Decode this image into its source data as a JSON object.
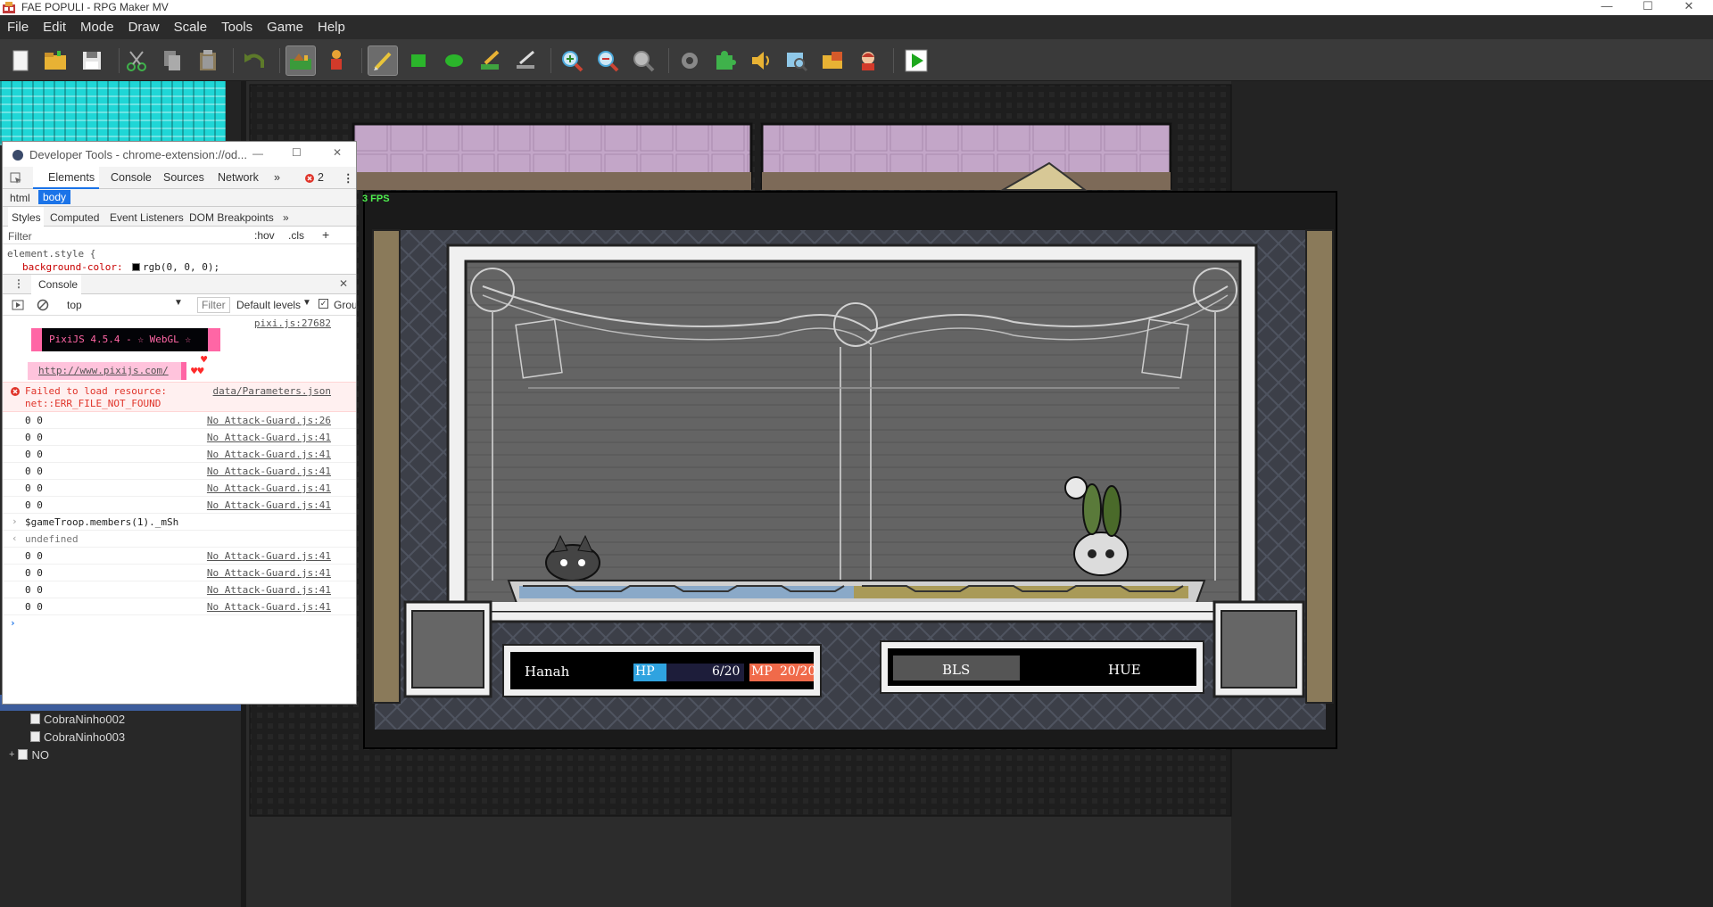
{
  "window": {
    "title": "FAE POPULI - RPG Maker MV",
    "minimize": "—",
    "maximize": "☐",
    "close": "✕"
  },
  "menu": [
    "File",
    "Edit",
    "Mode",
    "Draw",
    "Scale",
    "Tools",
    "Game",
    "Help"
  ],
  "tree": {
    "items": [
      {
        "label": "CobraNinho002"
      },
      {
        "label": "CobraNinho003"
      },
      {
        "label": "NO"
      }
    ],
    "expander": "+"
  },
  "devtools": {
    "title": "Developer Tools - chrome-extension://od...",
    "tabs": [
      "Elements",
      "Console",
      "Sources",
      "Network"
    ],
    "more": "»",
    "error_count": "2",
    "crumbs": [
      "html",
      "body"
    ],
    "subtabs": [
      "Styles",
      "Computed",
      "Event Listeners",
      "DOM Breakpoints"
    ],
    "filter_placeholder": "Filter",
    "hov": ":hov",
    "cls": ".cls",
    "plus": "+",
    "style_selector": "element.style {",
    "style_prop": "background-color:",
    "style_value": "rgb(0, 0, 0);",
    "console_tab": "Console",
    "context": "top",
    "console_filter": "Filter",
    "levels": "Default levels",
    "group": "Grou",
    "pixi_src": "pixi.js:27682",
    "pixi_banner": "PixiJS 4.5.4 - ☆ WebGL ☆",
    "pixi_url": "http://www.pixijs.com/",
    "hearts": "♥♥",
    "heart": "♥",
    "error_line1": "Failed to load resource:",
    "error_line2": "net::ERR_FILE_NOT_FOUND",
    "error_src": "data/Parameters.json",
    "logs_a": [
      {
        "msg": "0 0",
        "src": "No Attack-Guard.js:26"
      },
      {
        "msg": "0 0",
        "src": "No Attack-Guard.js:41"
      },
      {
        "msg": "0 0",
        "src": "No Attack-Guard.js:41"
      },
      {
        "msg": "0 0",
        "src": "No Attack-Guard.js:41"
      },
      {
        "msg": "0 0",
        "src": "No Attack-Guard.js:41"
      },
      {
        "msg": "0 0",
        "src": "No Attack-Guard.js:41"
      }
    ],
    "command": "$gameTroop.members(1)._mSh",
    "result": "undefined",
    "logs_b": [
      {
        "msg": "0 0",
        "src": "No Attack-Guard.js:41"
      },
      {
        "msg": "0 0",
        "src": "No Attack-Guard.js:41"
      },
      {
        "msg": "0 0",
        "src": "No Attack-Guard.js:41"
      },
      {
        "msg": "0 0",
        "src": "No Attack-Guard.js:41"
      }
    ],
    "prompt": "›",
    "in_arrow": "›",
    "out_arrow": "‹"
  },
  "game": {
    "fps": "3 FPS",
    "actor_name": "Hanah",
    "hp_label": "HP",
    "hp_value": "6/20",
    "hp_fraction": 0.3,
    "mp_label": "MP",
    "mp_value": "20/20",
    "cmd_left": "BLS",
    "cmd_right": "HUE"
  },
  "colors": {
    "hp_bar": "#2fa3e0",
    "mp_bar": "#f06a4a",
    "stage_frame": "#f0f0f0",
    "wall_purple": "#c3a6c8"
  }
}
